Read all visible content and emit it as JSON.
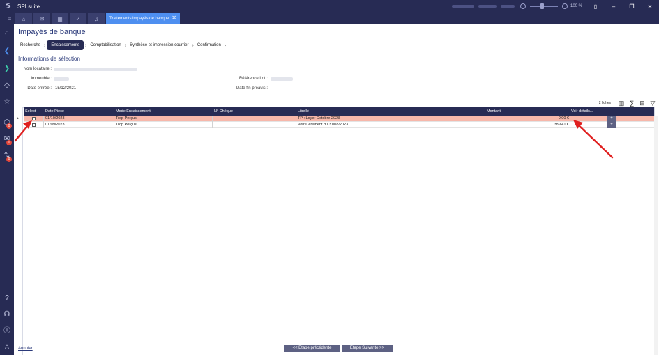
{
  "titlebar": {
    "app_name": "SPI suite",
    "zoom": "100 %"
  },
  "tabs": {
    "doc_tab": "Traitements impayés de banque"
  },
  "nav": {
    "badge_1": "0",
    "badge_2": "0",
    "badge_3": "0"
  },
  "page": {
    "title": "Impayés de banque"
  },
  "steps": [
    "Recherche",
    "Encaissements",
    "Comptabilisation",
    "Synthèse et impression courrier",
    "Confirmation"
  ],
  "section": {
    "title": "Informations de sélection"
  },
  "fields": {
    "nom_locataire_label": "Nom locataire :",
    "immeuble_label": "Immeuble :",
    "date_entree_label": "Date entrée :",
    "date_entree_value": "15/12/2021",
    "reference_lot_label": "Référence Lot :",
    "date_fin_preavis_label": "Date fin préavis :"
  },
  "toolbar": {
    "count": "2 fiches"
  },
  "grid": {
    "headers": [
      "Select",
      "Date Piece",
      "Mode Encaissement",
      "N° Chèque",
      "Libellé",
      "Montant",
      "Voir détails..."
    ],
    "rows": [
      {
        "date": "01/10/2023",
        "mode": "Trop Perçus",
        "cheque": "",
        "libelle": "TP : Loyer Octobre     2023",
        "montant": "0,00 €",
        "detail": "+",
        "selected": true
      },
      {
        "date": "01/09/2023",
        "mode": "Trop Perçus",
        "cheque": "",
        "libelle": "Votre virement du 31/08/2023",
        "montant": "389,41 €",
        "detail": "+",
        "selected": false
      }
    ]
  },
  "footer": {
    "cancel": "Annuler",
    "prev": "<< Etape précédente",
    "next": "Etape Suivante >>"
  },
  "colors": {
    "nav_bg": "#272b54",
    "accent_tab": "#4e8ff0",
    "selected_row": "#f7b7aa",
    "arrow": "#e02020"
  }
}
